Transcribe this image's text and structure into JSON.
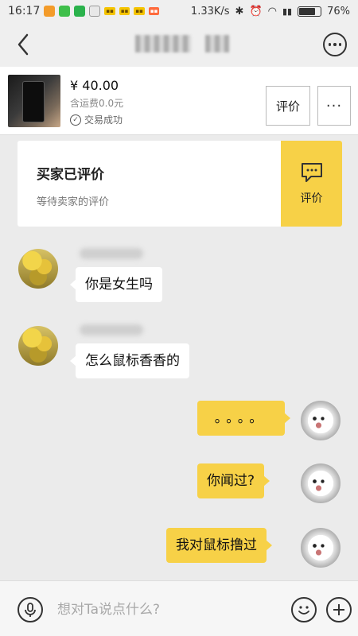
{
  "status_bar": {
    "time": "16:17",
    "network_speed": "1.33K/s",
    "battery": "76%",
    "battery_level": 0.76
  },
  "product": {
    "price": "¥ 40.00",
    "shipping": "含运费0.0元",
    "deal_status": "交易成功",
    "review_button": "评价",
    "more_button": "···"
  },
  "review_card": {
    "title": "买家已评价",
    "subtitle": "等待卖家的评价",
    "action_label": "评价"
  },
  "messages": [
    {
      "side": "left",
      "text": "你是女生吗"
    },
    {
      "side": "left",
      "text": "怎么鼠标香香的"
    },
    {
      "side": "right",
      "text": "。。。。"
    },
    {
      "side": "right",
      "text": "你闻过?"
    },
    {
      "side": "right",
      "text": "我对鼠标撸过"
    }
  ],
  "input": {
    "placeholder": "想对Ta说点什么?"
  },
  "colors": {
    "accent_yellow": "#f7d147",
    "background": "#ebebeb"
  }
}
